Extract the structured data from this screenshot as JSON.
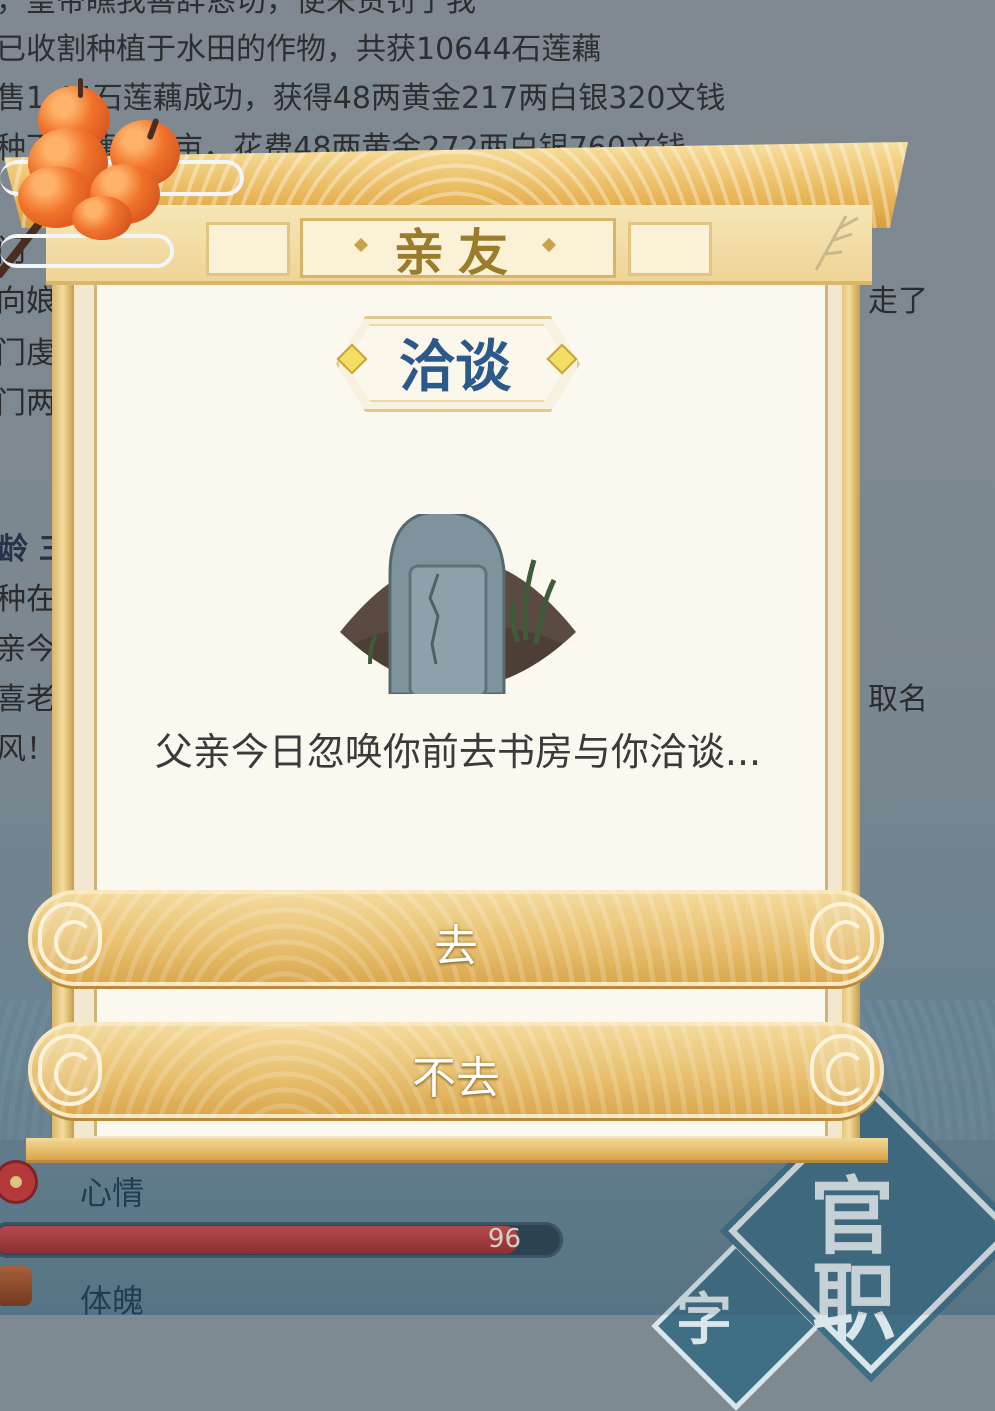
{
  "background_log": {
    "lines": [
      "，皇帝瞧我善辞恳切，便未责罚于我",
      "已收割种植于水田的作物，共获10644石莲藕",
      "售1 44石莲藕成功，获得48两黄金217两白银320文钱",
      "种下莲藕951亩，花费48两黄金272两白银760文钱"
    ],
    "left_fragments": [
      "门",
      "向娘",
      "门虔",
      "门两",
      "种在",
      "亲今",
      "喜老",
      "风！"
    ],
    "heading_fragment": "龄 三",
    "right_fragments": [
      "走了",
      "取名"
    ]
  },
  "stats": {
    "mood_label": "心情",
    "mood_value": "96",
    "mood_fraction": 0.93,
    "physique_label": "体魄"
  },
  "corner_seal": {
    "main": "官",
    "main2": "职",
    "secondary": "字"
  },
  "modal": {
    "title": "亲友",
    "badge": "洽谈",
    "illustration": "tombstone-icon",
    "message": "父亲今日忽唤你前去书房与你洽谈...",
    "buttons": {
      "go": "去",
      "not_go": "不去"
    }
  },
  "colors": {
    "title_text": "#9b7c2d",
    "badge_text": "#2b5a8a",
    "button_gold": "#e7be6c",
    "mood_bar": "#c64d4d"
  }
}
